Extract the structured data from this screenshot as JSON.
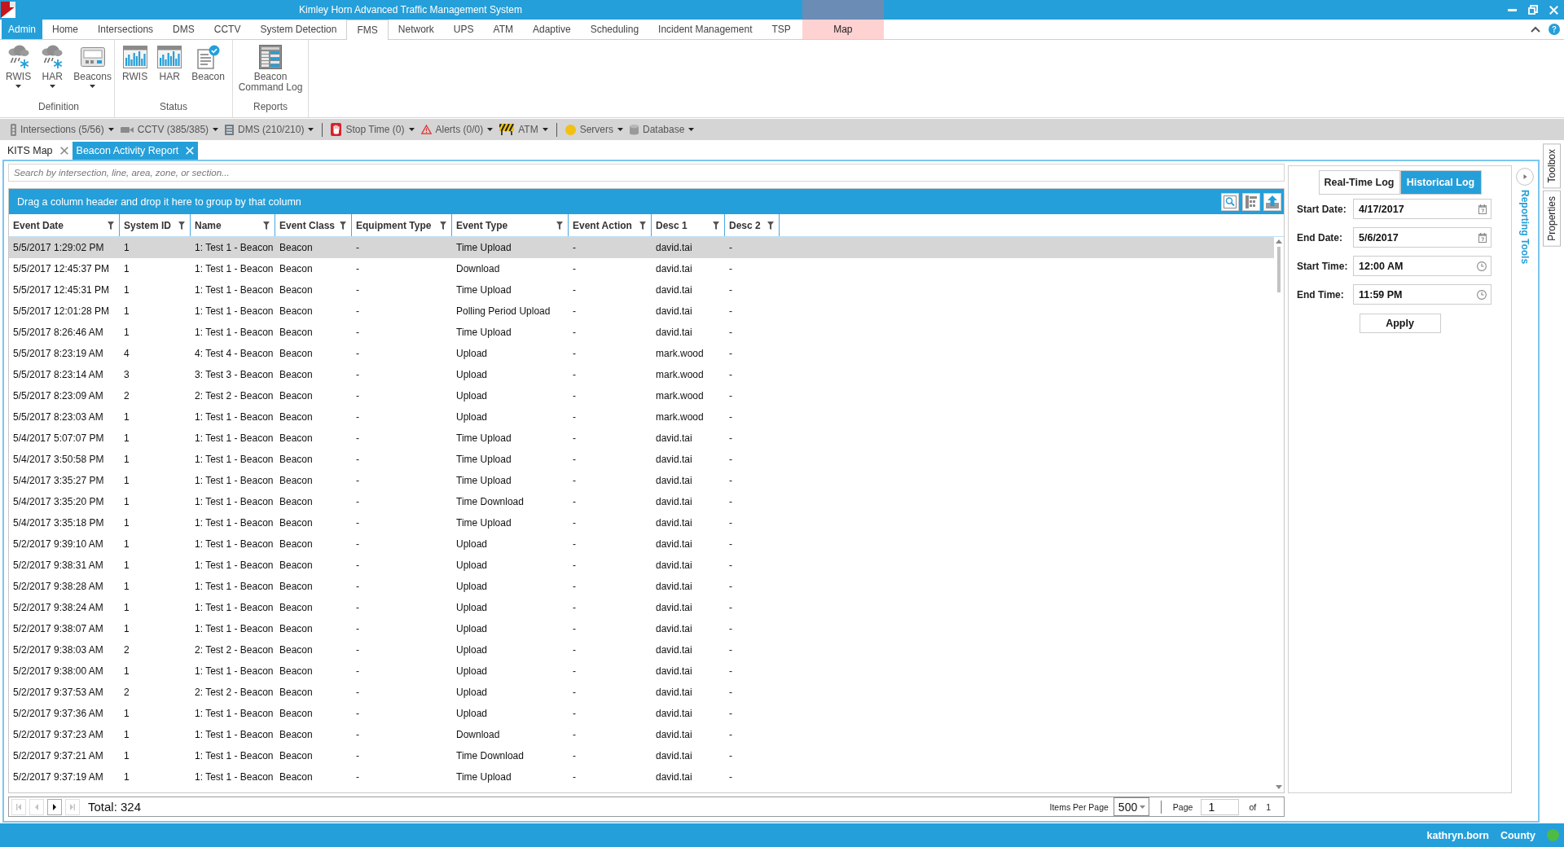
{
  "window": {
    "title": "Kimley Horn Advanced Traffic Management System"
  },
  "ribbon_tabs": [
    {
      "label": "Admin",
      "kind": "menu",
      "selected": false
    },
    {
      "label": "Home",
      "kind": "tab",
      "selected": false
    },
    {
      "label": "Intersections",
      "kind": "tab",
      "selected": false
    },
    {
      "label": "DMS",
      "kind": "tab",
      "selected": false
    },
    {
      "label": "CCTV",
      "kind": "tab",
      "selected": false
    },
    {
      "label": "System Detection",
      "kind": "tab",
      "selected": false
    },
    {
      "label": "FMS",
      "kind": "tab",
      "selected": true
    },
    {
      "label": "Network",
      "kind": "tab",
      "selected": false
    },
    {
      "label": "UPS",
      "kind": "tab",
      "selected": false
    },
    {
      "label": "ATM",
      "kind": "tab",
      "selected": false
    },
    {
      "label": "Adaptive",
      "kind": "tab",
      "selected": false
    },
    {
      "label": "Scheduling",
      "kind": "tab",
      "selected": false
    },
    {
      "label": "Incident Management",
      "kind": "tab",
      "selected": false
    },
    {
      "label": "TSP",
      "kind": "tab",
      "selected": false
    },
    {
      "label": "Map",
      "kind": "contextual",
      "selected": false
    }
  ],
  "ribbon_groups": [
    {
      "label": "Definition",
      "buttons": [
        {
          "label": "RWIS",
          "dropdown": true
        },
        {
          "label": "HAR",
          "dropdown": true
        },
        {
          "label": "Beacons",
          "dropdown": true
        }
      ]
    },
    {
      "label": "Status",
      "buttons": [
        {
          "label": "RWIS",
          "dropdown": false
        },
        {
          "label": "HAR",
          "dropdown": false
        },
        {
          "label": "Beacon",
          "dropdown": false
        }
      ]
    },
    {
      "label": "Reports",
      "buttons": [
        {
          "label": "Beacon Command Log",
          "dropdown": false
        }
      ]
    }
  ],
  "status_toolbar": {
    "groups": [
      {
        "items": [
          {
            "label": "Intersections (5/56)"
          },
          {
            "label": "CCTV (385/385)"
          },
          {
            "label": "DMS (210/210)"
          }
        ]
      },
      {
        "items": [
          {
            "label": "Stop Time (0)"
          },
          {
            "label": "Alerts (0/0)"
          },
          {
            "label": "ATM"
          }
        ]
      },
      {
        "items": [
          {
            "label": "Servers"
          },
          {
            "label": "Database"
          }
        ]
      }
    ]
  },
  "document_tabs": [
    {
      "label": "KITS Map",
      "selected": false
    },
    {
      "label": "Beacon Activity Report",
      "selected": true
    }
  ],
  "search": {
    "placeholder": "Search by intersection, line, area, zone, or section..."
  },
  "grid": {
    "group_panel": "Drag a column header and drop it here to group by that column",
    "columns": [
      "Event Date",
      "System ID",
      "Name",
      "Event Class",
      "Equipment Type",
      "Event Type",
      "Event Action",
      "Desc 1",
      "Desc 2"
    ],
    "rows": [
      {
        "selected": true,
        "cells": [
          "5/5/2017 1:29:02 PM",
          "1",
          "1: Test 1 - Beacon",
          "Beacon",
          "-",
          "Time Upload",
          "-",
          "david.tai",
          "-"
        ]
      },
      {
        "selected": false,
        "cells": [
          "5/5/2017 12:45:37 PM",
          "1",
          "1: Test 1 - Beacon",
          "Beacon",
          "-",
          "Download",
          "-",
          "david.tai",
          "-"
        ]
      },
      {
        "selected": false,
        "cells": [
          "5/5/2017 12:45:31 PM",
          "1",
          "1: Test 1 - Beacon",
          "Beacon",
          "-",
          "Time Upload",
          "-",
          "david.tai",
          "-"
        ]
      },
      {
        "selected": false,
        "cells": [
          "5/5/2017 12:01:28 PM",
          "1",
          "1: Test 1 - Beacon",
          "Beacon",
          "-",
          "Polling Period Upload",
          "-",
          "david.tai",
          "-"
        ]
      },
      {
        "selected": false,
        "cells": [
          "5/5/2017 8:26:46 AM",
          "1",
          "1: Test 1 - Beacon",
          "Beacon",
          "-",
          "Time Upload",
          "-",
          "david.tai",
          "-"
        ]
      },
      {
        "selected": false,
        "cells": [
          "5/5/2017 8:23:19 AM",
          "4",
          "4: Test 4 - Beacon",
          "Beacon",
          "-",
          "Upload",
          "-",
          "mark.wood",
          "-"
        ]
      },
      {
        "selected": false,
        "cells": [
          "5/5/2017 8:23:14 AM",
          "3",
          "3: Test 3 - Beacon",
          "Beacon",
          "-",
          "Upload",
          "-",
          "mark.wood",
          "-"
        ]
      },
      {
        "selected": false,
        "cells": [
          "5/5/2017 8:23:09 AM",
          "2",
          "2: Test 2 - Beacon",
          "Beacon",
          "-",
          "Upload",
          "-",
          "mark.wood",
          "-"
        ]
      },
      {
        "selected": false,
        "cells": [
          "5/5/2017 8:23:03 AM",
          "1",
          "1: Test 1 - Beacon",
          "Beacon",
          "-",
          "Upload",
          "-",
          "mark.wood",
          "-"
        ]
      },
      {
        "selected": false,
        "cells": [
          "5/4/2017 5:07:07 PM",
          "1",
          "1: Test 1 - Beacon",
          "Beacon",
          "-",
          "Time Upload",
          "-",
          "david.tai",
          "-"
        ]
      },
      {
        "selected": false,
        "cells": [
          "5/4/2017 3:50:58 PM",
          "1",
          "1: Test 1 - Beacon",
          "Beacon",
          "-",
          "Time Upload",
          "-",
          "david.tai",
          "-"
        ]
      },
      {
        "selected": false,
        "cells": [
          "5/4/2017 3:35:27 PM",
          "1",
          "1: Test 1 - Beacon",
          "Beacon",
          "-",
          "Time Upload",
          "-",
          "david.tai",
          "-"
        ]
      },
      {
        "selected": false,
        "cells": [
          "5/4/2017 3:35:20 PM",
          "1",
          "1: Test 1 - Beacon",
          "Beacon",
          "-",
          "Time Download",
          "-",
          "david.tai",
          "-"
        ]
      },
      {
        "selected": false,
        "cells": [
          "5/4/2017 3:35:18 PM",
          "1",
          "1: Test 1 - Beacon",
          "Beacon",
          "-",
          "Time Upload",
          "-",
          "david.tai",
          "-"
        ]
      },
      {
        "selected": false,
        "cells": [
          "5/2/2017 9:39:10 AM",
          "1",
          "1: Test 1 - Beacon",
          "Beacon",
          "-",
          "Upload",
          "-",
          "david.tai",
          "-"
        ]
      },
      {
        "selected": false,
        "cells": [
          "5/2/2017 9:38:31 AM",
          "1",
          "1: Test 1 - Beacon",
          "Beacon",
          "-",
          "Upload",
          "-",
          "david.tai",
          "-"
        ]
      },
      {
        "selected": false,
        "cells": [
          "5/2/2017 9:38:28 AM",
          "1",
          "1: Test 1 - Beacon",
          "Beacon",
          "-",
          "Upload",
          "-",
          "david.tai",
          "-"
        ]
      },
      {
        "selected": false,
        "cells": [
          "5/2/2017 9:38:24 AM",
          "1",
          "1: Test 1 - Beacon",
          "Beacon",
          "-",
          "Upload",
          "-",
          "david.tai",
          "-"
        ]
      },
      {
        "selected": false,
        "cells": [
          "5/2/2017 9:38:07 AM",
          "1",
          "1: Test 1 - Beacon",
          "Beacon",
          "-",
          "Upload",
          "-",
          "david.tai",
          "-"
        ]
      },
      {
        "selected": false,
        "cells": [
          "5/2/2017 9:38:03 AM",
          "2",
          "2: Test 2 - Beacon",
          "Beacon",
          "-",
          "Upload",
          "-",
          "david.tai",
          "-"
        ]
      },
      {
        "selected": false,
        "cells": [
          "5/2/2017 9:38:00 AM",
          "1",
          "1: Test 1 - Beacon",
          "Beacon",
          "-",
          "Upload",
          "-",
          "david.tai",
          "-"
        ]
      },
      {
        "selected": false,
        "cells": [
          "5/2/2017 9:37:53 AM",
          "2",
          "2: Test 2 - Beacon",
          "Beacon",
          "-",
          "Upload",
          "-",
          "david.tai",
          "-"
        ]
      },
      {
        "selected": false,
        "cells": [
          "5/2/2017 9:37:36 AM",
          "1",
          "1: Test 1 - Beacon",
          "Beacon",
          "-",
          "Upload",
          "-",
          "david.tai",
          "-"
        ]
      },
      {
        "selected": false,
        "cells": [
          "5/2/2017 9:37:23 AM",
          "1",
          "1: Test 1 - Beacon",
          "Beacon",
          "-",
          "Download",
          "-",
          "david.tai",
          "-"
        ]
      },
      {
        "selected": false,
        "cells": [
          "5/2/2017 9:37:21 AM",
          "1",
          "1: Test 1 - Beacon",
          "Beacon",
          "-",
          "Time Download",
          "-",
          "david.tai",
          "-"
        ]
      },
      {
        "selected": false,
        "cells": [
          "5/2/2017 9:37:19 AM",
          "1",
          "1: Test 1 - Beacon",
          "Beacon",
          "-",
          "Time Upload",
          "-",
          "david.tai",
          "-"
        ]
      }
    ]
  },
  "pager": {
    "buttons": [
      {
        "disabled": true
      },
      {
        "disabled": true
      },
      {
        "disabled": false
      },
      {
        "disabled": true
      }
    ],
    "total": "Total: 324",
    "items_per_page_label": "Items Per Page",
    "items_per_page": "500",
    "page_label": "Page",
    "page": "1",
    "of_label": "of",
    "page_count": "1"
  },
  "report_panel": {
    "modes": [
      {
        "label": "Real-Time Log",
        "selected": false
      },
      {
        "label": "Historical Log",
        "selected": true
      }
    ],
    "fields": [
      {
        "label": "Start Date:",
        "value": "4/17/2017",
        "kind": "date"
      },
      {
        "label": "End Date:",
        "value": "5/6/2017",
        "kind": "date"
      },
      {
        "label": "Start Time:",
        "value": "12:00 AM",
        "kind": "time"
      },
      {
        "label": "End Time:",
        "value": "11:59 PM",
        "kind": "time"
      }
    ],
    "apply": "Apply"
  },
  "reporting_strip": {
    "label": "Reporting Tools"
  },
  "side_tabs": [
    {
      "label": "Toolbox",
      "selected": false
    },
    {
      "label": "Properties",
      "selected": false
    }
  ],
  "status_bar": {
    "user": "kathryn.born",
    "scope": "County"
  }
}
